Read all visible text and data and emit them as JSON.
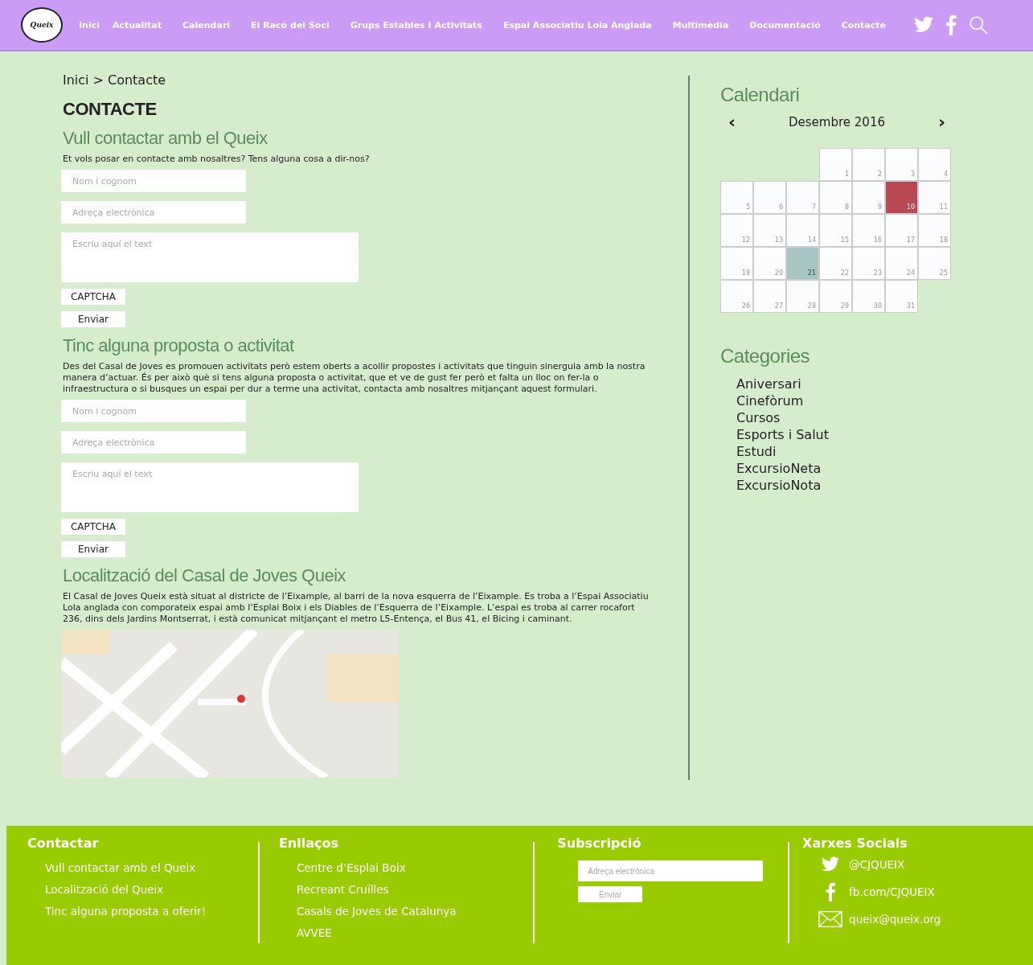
{
  "header": {
    "logo_text": "Queix",
    "nav": [
      {
        "label": "Inici"
      },
      {
        "label": "Actualitat"
      },
      {
        "label": "Calendari"
      },
      {
        "label": "El Racó del Soci"
      },
      {
        "label": "Grups Estables I Activitats"
      },
      {
        "label": "Espai Associatiu Lola Anglada"
      },
      {
        "label": "Multimèdia"
      },
      {
        "label": "Documentació"
      },
      {
        "label": "Contacte"
      }
    ]
  },
  "breadcrumb": {
    "home": "Inici",
    "separator": ">",
    "current": "Contacte"
  },
  "page_title": "CONTACTE",
  "sections": [
    {
      "kind": "form",
      "heading": "Vull contactar amb el Queix",
      "text": "Et vols posar en contacte amb nosaltres? Tens alguna cosa a dir-nos?",
      "name_placeholder": "Nom i cognom",
      "email_placeholder": "Adreça electrònica",
      "message_placeholder": "Escriu aquí el text",
      "captcha": "CAPTCHA",
      "submit": "Enviar"
    },
    {
      "kind": "form",
      "heading": "Tinc alguna proposta o activitat",
      "text": "Des del Casal de Joves es promouen activitats però estem oberts a acollir propostes i activitats que tinguin sinerguia amb la nostra manera d’actuar. És per això què si tens alguna proposta o activitat, que et ve de gust fer però et falta un lloc on fer-la o infraestructura o si busques un espai per dur a terme una activitat, contacta amb nosaltres mitjançant aquest formulari.",
      "name_placeholder": "Nom i cognom",
      "email_placeholder": "Adreça electrònica",
      "message_placeholder": "Escriu aquí el text",
      "captcha": "CAPTCHA",
      "submit": "Enviar"
    },
    {
      "kind": "map",
      "heading": "Localització del Casal de Joves Queix",
      "text": "El Casal de Joves Queix està situat al districte de l’Eixample, al barri de la nova esquerra de l’Eixample. Es troba a l’Espai Associatiu Lola anglada con comporateix espai amb l’Esplai Boix i els Diables de l’Esquerra de l’Eixample. L’espai es troba al carrer rocafort 236, dins dels Jardins Montserrat, i està comunicat mitjançant el metro L5-Entença, el Bus 41, el Bicing i caminant."
    }
  ],
  "sidebar": {
    "calendar": {
      "title": "Calendari",
      "month": "Desembre 2016",
      "prev": "‹",
      "next": "›",
      "weeks": [
        {
          "days": [
            {
              "day": "1",
              "kind": "plain"
            },
            {
              "day": "2",
              "kind": "plain"
            },
            {
              "day": "3",
              "kind": "plain"
            },
            {
              "day": "4",
              "kind": "plain"
            }
          ]
        },
        {
          "days": [
            {
              "day": "5",
              "kind": "plain"
            },
            {
              "day": "6",
              "kind": "plain"
            },
            {
              "day": "7",
              "kind": "plain"
            },
            {
              "day": "8",
              "kind": "plain"
            },
            {
              "day": "9",
              "kind": "plain"
            },
            {
              "day": "10",
              "kind": "event"
            },
            {
              "day": "11",
              "kind": "plain"
            }
          ]
        },
        {
          "days": [
            {
              "day": "12",
              "kind": "plain"
            },
            {
              "day": "13",
              "kind": "plain"
            },
            {
              "day": "14",
              "kind": "plain"
            },
            {
              "day": "15",
              "kind": "plain"
            },
            {
              "day": "16",
              "kind": "plain"
            },
            {
              "day": "17",
              "kind": "plain"
            },
            {
              "day": "18",
              "kind": "plain"
            }
          ]
        },
        {
          "days": [
            {
              "day": "19",
              "kind": "plain"
            },
            {
              "day": "20",
              "kind": "plain"
            },
            {
              "day": "21",
              "kind": "today"
            },
            {
              "day": "22",
              "kind": "plain"
            },
            {
              "day": "23",
              "kind": "plain"
            },
            {
              "day": "24",
              "kind": "plain"
            },
            {
              "day": "25",
              "kind": "plain"
            }
          ]
        },
        {
          "days": [
            {
              "day": "26",
              "kind": "plain"
            },
            {
              "day": "27",
              "kind": "plain"
            },
            {
              "day": "28",
              "kind": "plain"
            },
            {
              "day": "29",
              "kind": "plain"
            },
            {
              "day": "30",
              "kind": "plain"
            },
            {
              "day": "31",
              "kind": "plain"
            }
          ]
        }
      ]
    },
    "categories": {
      "title": "Categories",
      "items": [
        "Aniversari",
        "Cinefòrum",
        "Cursos",
        "Esports i Salut",
        "Estudi",
        "ExcursioNeta",
        "ExcursioNota"
      ]
    }
  },
  "footer": {
    "columns": [
      {
        "kind": "links",
        "title": "Contactar",
        "links": [
          "Vull contactar amb el Queix",
          "Localització del Queix",
          "Tinc alguna proposta a oferir!"
        ]
      },
      {
        "kind": "links",
        "title": "Enllaços",
        "links": [
          "Centre d’Esplai Boix",
          "Recreant Cruïlles",
          "Casals de Joves de Catalunya",
          "AVVEE"
        ]
      },
      {
        "kind": "subscribe",
        "title": "Subscripció",
        "email_placeholder": "Adreça electrònica",
        "submit": "Enviar"
      },
      {
        "kind": "social",
        "title": "Xarxes Socials",
        "items": [
          {
            "kind": "twitter",
            "label": "@CJQUEIX"
          },
          {
            "kind": "facebook",
            "label": "fb.com/CJQUEIX"
          },
          {
            "kind": "mail",
            "label": "queix@queix.org"
          }
        ]
      }
    ]
  }
}
